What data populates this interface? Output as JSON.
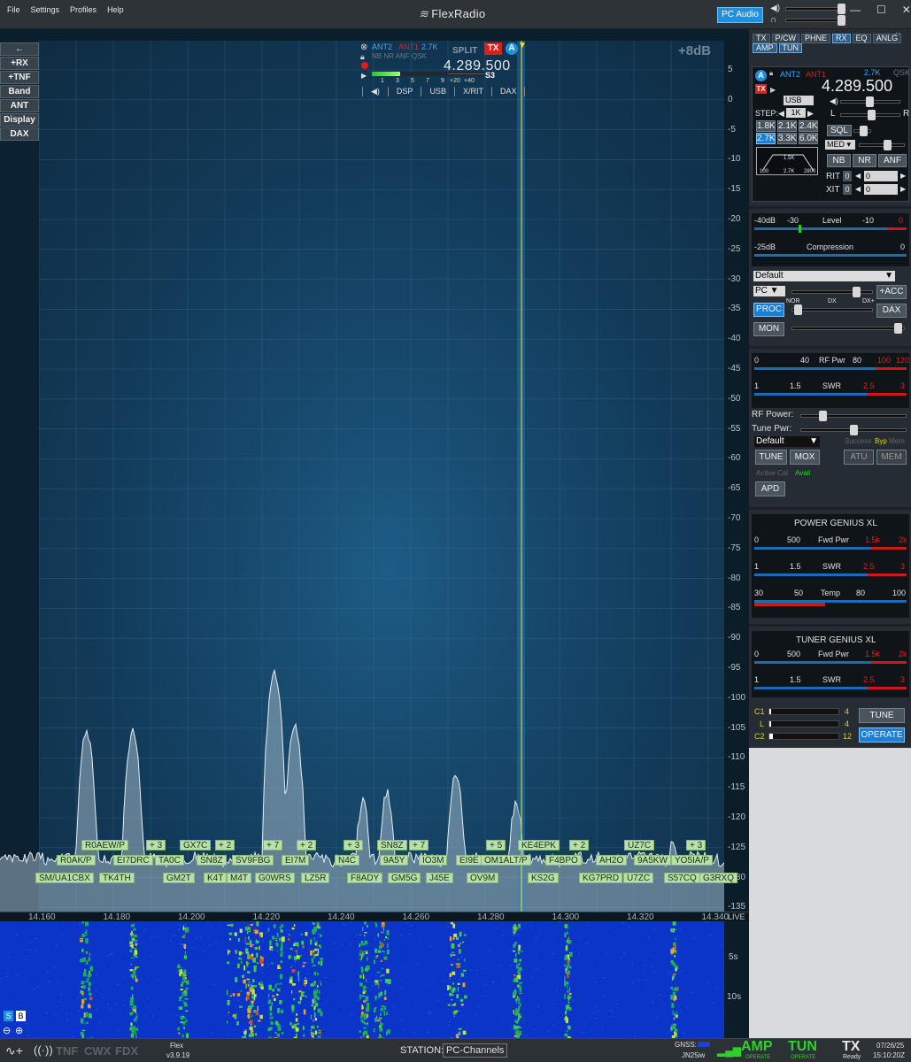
{
  "window": {
    "menu": [
      "File",
      "Settings",
      "Profiles",
      "Help"
    ],
    "logo": "FlexRadio",
    "pc_audio": "PC Audio"
  },
  "panadapter": {
    "left_buttons": [
      "←",
      "+RX",
      "+TNF",
      "Band",
      "ANT",
      "Display",
      "DAX"
    ],
    "gain": "+8dB",
    "db_scale": [
      "5",
      "0",
      "-5",
      "-10",
      "-15",
      "-20",
      "-25",
      "-30",
      "-35",
      "-40",
      "-45",
      "-50",
      "-55",
      "-60",
      "-65",
      "-70",
      "-75",
      "-80",
      "-85",
      "-90",
      "-95",
      "-100",
      "-105",
      "-110",
      "-115",
      "-120",
      "-125",
      "-130",
      "-135"
    ],
    "freq_labels": [
      "14.160",
      "14.180",
      "14.200",
      "14.220",
      "14.240",
      "14.260",
      "14.280",
      "14.300",
      "14.320",
      "14.340"
    ],
    "live": "LIVE",
    "waterfall_times": [
      "5s",
      "10s"
    ]
  },
  "slice": {
    "rx_ant": "ANT2",
    "tx_ant": "ANT1",
    "filter": "2.7K",
    "split": "SPLIT",
    "tx": "TX",
    "letter": "A",
    "flags": "NB NR ANF QSK",
    "frequency": "4.289.500",
    "smeter_scale": [
      "1",
      "3",
      "5",
      "7",
      "9",
      "+20",
      "+40"
    ],
    "s_reading": "S3",
    "toolbar": [
      "◀)",
      "DSP",
      "USB",
      "X/RIT",
      "DAX"
    ]
  },
  "spots": {
    "row1": [
      "R0AEW/P",
      "+ 3",
      "GX7C",
      "+ 2",
      "+ 7",
      "+ 2",
      "+ 3",
      "SN8Z",
      "+ 7",
      "+ 5",
      "KE4EPK",
      "+ 2",
      "UZ7C",
      "+ 3"
    ],
    "row2": [
      "R0AK/P",
      "EI7DRC",
      "TA0C",
      "SN8Z",
      "SV9FBG",
      "EI7M",
      "N4C",
      "9A5Y",
      "IO3M",
      "EI9E",
      "OM1ALT/P",
      "F4BPO",
      "AH2O",
      "9A5KW",
      "YO5IA/P"
    ],
    "row3": [
      "SM/UA1CBX",
      "TK4TH",
      "GM2T",
      "K4T",
      "M4T",
      "G0WRS",
      "LZ5R",
      "F8ADY",
      "GM5G",
      "J45E",
      "OV9M",
      "KS2G",
      "KG7PRD",
      "U7ZC",
      "S57CQ",
      "G3RXQ"
    ]
  },
  "rpanel": {
    "tabs_row1": [
      "TX",
      "P/CW",
      "PHNE",
      "RX",
      "EQ",
      "ANLG"
    ],
    "tabs_row2": [
      "AMP",
      "TUN"
    ],
    "slice": {
      "ant_rx": "ANT2",
      "ant_tx": "ANT1",
      "filter": "2.7K",
      "qsk": "QSK",
      "freq": "4.289.500",
      "mode": "USB"
    },
    "step_label": "STEP:",
    "step_value": "1K",
    "filters": [
      "1.8K",
      "2.1K",
      "2.4K",
      "2.7K",
      "3.3K",
      "6.0K"
    ],
    "filter_graph": [
      "1.5K",
      "100",
      "2.7K",
      "2800"
    ],
    "sql": "SQL",
    "agc": "MED",
    "lr": [
      "L",
      "R"
    ],
    "dsp_buttons": [
      "NB",
      "NR",
      "ANF"
    ],
    "rit_label": "RIT",
    "xit_label": "XIT",
    "rit_value": "0",
    "xit_value": "0",
    "level_scale": [
      "-40dB",
      "-30",
      "Level",
      "-10",
      "0"
    ],
    "comp_scale": [
      "-25dB",
      "Compression",
      "0"
    ],
    "profile": "Default",
    "mic": "PC",
    "acc": "+ACC",
    "proc_scale": [
      "NOR",
      "DX",
      "DX+"
    ],
    "proc": "PROC",
    "dax": "DAX",
    "mon": "MON",
    "rfpwr_scale": [
      "0",
      "40",
      "RF Pwr",
      "80",
      "100",
      "120"
    ],
    "swr_scale": [
      "1",
      "1.5",
      "SWR",
      "2.5",
      "3"
    ],
    "rf_power_label": "RF Power:",
    "tune_pwr_label": "Tune Pwr:",
    "tx_profile": "Default",
    "atu_status": [
      "Success",
      "Byp",
      "Mem"
    ],
    "tune": "TUNE",
    "mox": "MOX",
    "atu": "ATU",
    "mem": "MEM",
    "active_cal": "Active Cal",
    "avail": "Avail",
    "apd": "APD",
    "pg_title": "POWER GENIUS XL",
    "pg_fwd_scale": [
      "0",
      "500",
      "Fwd Pwr",
      "1.5k",
      "2k"
    ],
    "pg_swr_scale": [
      "1",
      "1.5",
      "SWR",
      "2.5",
      "3"
    ],
    "pg_temp_scale": [
      "30",
      "50",
      "Temp",
      "80",
      "100"
    ],
    "tg_title": "TUNER GENIUS XL",
    "tg_fwd_scale": [
      "0",
      "500",
      "Fwd Pwr",
      "1.5k",
      "2k"
    ],
    "tg_swr_scale": [
      "1",
      "1.5",
      "SWR",
      "2.5",
      "3"
    ],
    "tg_labels": [
      "C1",
      "L",
      "C2"
    ],
    "tg_values": [
      "4",
      "4",
      "12"
    ],
    "tg_tune": "TUNE",
    "tg_operate": "OPERATE"
  },
  "bottom": {
    "tnf": "TNF",
    "cwx": "CWX",
    "fdx": "FDX",
    "app": "Flex",
    "version": "v3.9.19",
    "station_label": "STATION:",
    "station": "PC-Channels",
    "gnss": "GNSS:",
    "grid": "JN25iw",
    "amp": "AMP",
    "amp_sub": "OPERATE",
    "tun": "TUN",
    "tun_sub": "OPERATE",
    "tx": "TX",
    "tx_sub": "Ready",
    "date": "07/26/25",
    "time": "15:10:20Z"
  },
  "colors": {
    "accent": "#1f8fe0",
    "spot": "#b8e0a8",
    "tx_red": "#e01c1c",
    "amp_green": "#2ed12e"
  }
}
